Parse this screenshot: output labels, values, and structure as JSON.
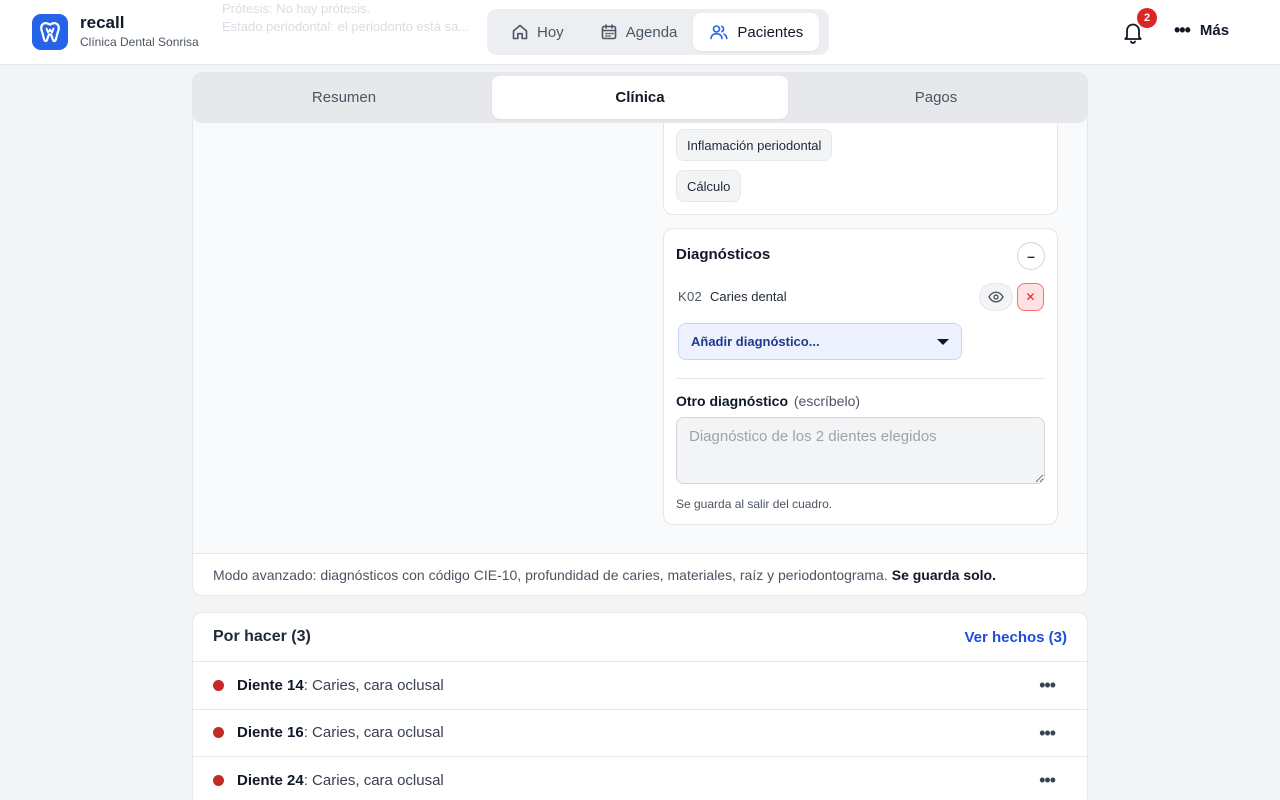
{
  "app": {
    "name": "recall",
    "clinic": "Clínica Dental Sonrisa",
    "logo_icon": "tooth-icon",
    "accent": "#2563eb"
  },
  "background_ghost": {
    "line1": "Prótesis: No hay prótesis.",
    "line2": "Estado periodontal: el periodonto está sa..."
  },
  "nav": {
    "items": [
      {
        "label": "Hoy",
        "icon": "home-icon"
      },
      {
        "label": "Agenda",
        "icon": "calendar-icon"
      },
      {
        "label": "Pacientes",
        "icon": "users-icon"
      }
    ],
    "active": "Pacientes"
  },
  "notifications": {
    "count": "2",
    "icon": "bell-icon"
  },
  "more": {
    "label": "Más",
    "icon": "more-dots-icon"
  },
  "subtabs": {
    "items": [
      "Resumen",
      "Clínica",
      "Pagos"
    ],
    "active": "Clínica"
  },
  "findings": {
    "chips": [
      "Inflamación periodontal",
      "Cálculo"
    ]
  },
  "diagnoses": {
    "title": "Diagnósticos",
    "collapse_label": "–",
    "items": [
      {
        "code": "K02",
        "name": "Caries dental"
      }
    ],
    "add_select_label": "Añadir diagnóstico...",
    "other_label": "Otro diagnóstico",
    "other_hint": "(escríbelo)",
    "other_placeholder": "Diagnóstico de los 2 dientes elegidos",
    "other_value": "",
    "save_note": "Se guarda al salir del cuadro."
  },
  "advanced_footer": {
    "text": "Modo avanzado: diagnósticos con código CIE-10, profundidad de caries, materiales, raíz y periodontograma.",
    "bold": "Se guarda solo."
  },
  "todo": {
    "title": "Por hacer (3)",
    "done_link": "Ver hechos (3)",
    "status_color": "#c62828",
    "items": [
      {
        "tooth": "Diente 14",
        "desc": ": Caries, cara oclusal"
      },
      {
        "tooth": "Diente 16",
        "desc": ": Caries, cara oclusal"
      },
      {
        "tooth": "Diente 24",
        "desc": ": Caries, cara oclusal"
      }
    ]
  }
}
